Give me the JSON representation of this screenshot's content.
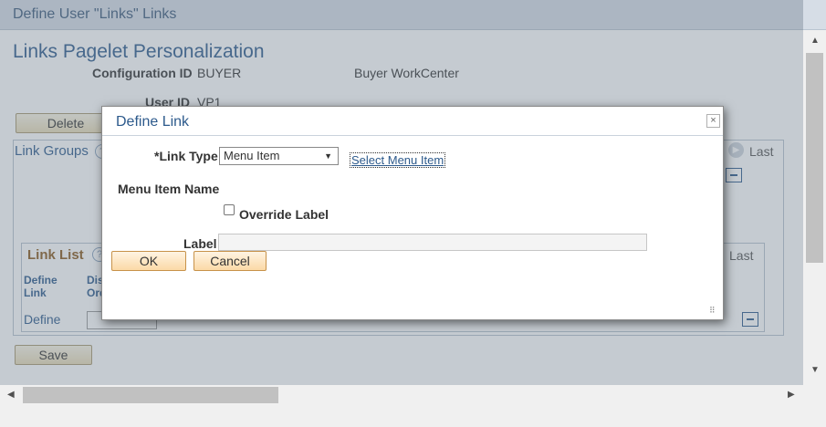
{
  "window_title": "Define User \"Links\" Links",
  "page": {
    "title": "Links Pagelet Personalization",
    "config_label": "Configuration ID",
    "config_value": "BUYER",
    "config_desc": "Buyer WorkCenter",
    "user_label": "User ID",
    "user_value": "VP1",
    "delete_button": "Delete",
    "link_groups": "Link Groups",
    "last": "Last",
    "link_list": "Link List",
    "col_define_link": "Define\nLink",
    "col_display_order": "Dis\nOrd",
    "row_define": "Define",
    "last2": "Last",
    "save_button": "Save",
    "help_glyph": "?"
  },
  "modal": {
    "title": "Define Link",
    "close_glyph": "×",
    "link_type_label": "*Link Type",
    "link_type_value": "Menu Item",
    "select_menu_item": "Select Menu Item",
    "menu_item_name_label": "Menu Item Name",
    "override_label": "Override Label",
    "override_checked": false,
    "label_label": "Label",
    "label_value": "",
    "ok_button": "OK",
    "cancel_button": "Cancel"
  },
  "icons": {
    "select_caret": "▼",
    "scroll_up": "▲",
    "scroll_down": "▼",
    "scroll_left": "◀",
    "scroll_right": "▶",
    "nav_next": "▶",
    "resize_grip": "⠿"
  }
}
